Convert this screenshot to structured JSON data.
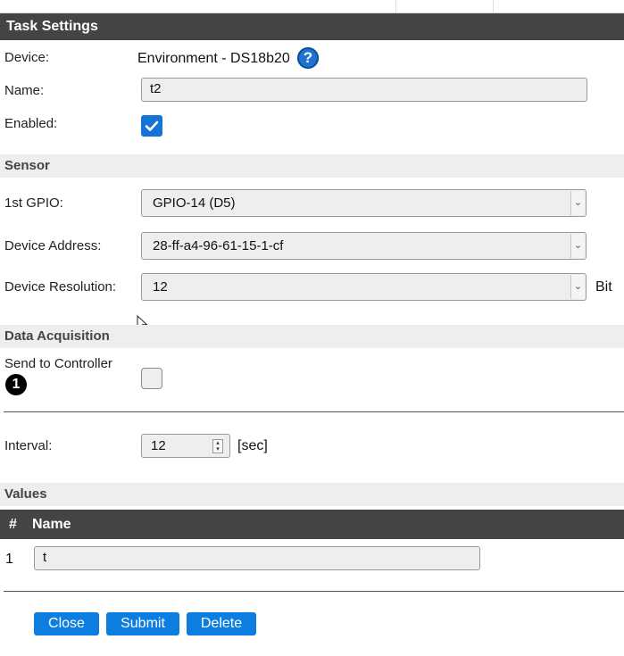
{
  "task_settings": {
    "title": "Task Settings",
    "device_label": "Device:",
    "device_value": "Environment - DS18b20",
    "help_glyph": "?",
    "name_label": "Name:",
    "name_value": "t2",
    "enabled_label": "Enabled:",
    "enabled_checked": true
  },
  "sensor": {
    "title": "Sensor",
    "gpio_label": "1st GPIO:",
    "gpio_value": "GPIO-14 (D5)",
    "address_label": "Device Address:",
    "address_value": "28-ff-a4-96-61-15-1-cf",
    "resolution_label": "Device Resolution:",
    "resolution_value": "12",
    "resolution_unit": "Bit"
  },
  "data_acquisition": {
    "title": "Data Acquisition",
    "send_label": "Send to Controller",
    "controller_badge": "1",
    "send_checked": false,
    "interval_label": "Interval:",
    "interval_value": "12",
    "interval_unit": "[sec]"
  },
  "values": {
    "title": "Values",
    "col_index": "#",
    "col_name": "Name",
    "rows": [
      {
        "index": "1",
        "name": "t"
      }
    ]
  },
  "buttons": {
    "close": "Close",
    "submit": "Submit",
    "delete": "Delete"
  },
  "colors": {
    "header_dark": "#444444",
    "section_light": "#eeeeee",
    "accent_blue": "#0d7ee0"
  },
  "icons": {
    "help": "question-circle-icon",
    "check": "checkmark-icon",
    "dropdown": "chevron-down-icon",
    "spinner": "spin-updown-icon",
    "cursor": "mouse-pointer-icon"
  }
}
